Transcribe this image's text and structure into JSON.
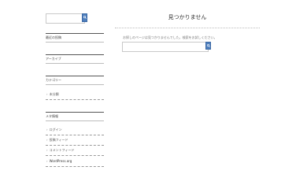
{
  "sidebar": {
    "search": {
      "placeholder": "",
      "button_icon": "search-icon"
    },
    "widgets": [
      {
        "title": "最近の投稿"
      },
      {
        "title": "アーカイブ"
      },
      {
        "title": "カテゴリー",
        "items": [
          "未分類"
        ]
      },
      {
        "title": "メタ情報",
        "items": [
          "ログイン",
          "投稿フィード",
          "コメントフィード",
          "WordPress.org"
        ]
      }
    ]
  },
  "main": {
    "title": "見つかりません",
    "message": "お探しのページは見つかりませんでした。検索をお試しください。",
    "search": {
      "placeholder": "",
      "button_icon": "search-icon"
    }
  },
  "colors": {
    "accent": "#4f7fbd"
  }
}
